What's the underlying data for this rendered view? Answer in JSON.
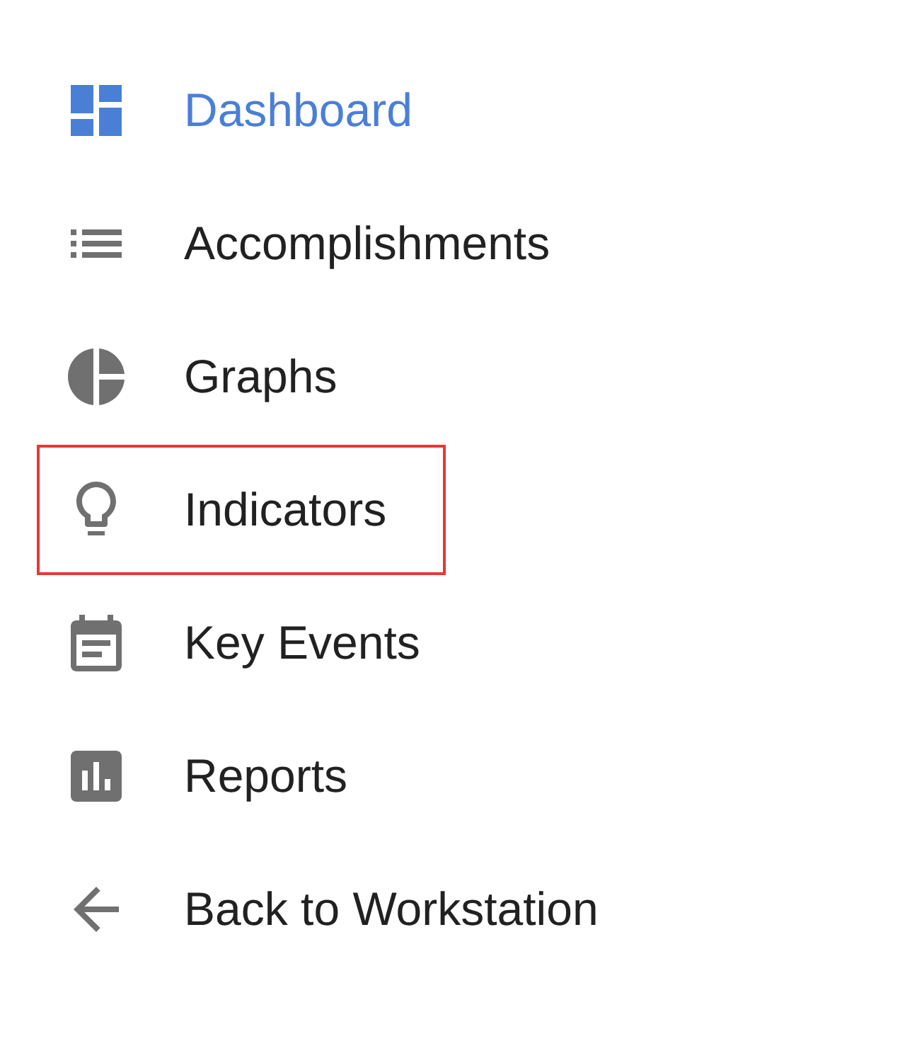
{
  "menu": [
    {
      "label": "Dashboard",
      "kind": "dashboard",
      "selected": true,
      "highlighted": false
    },
    {
      "label": "Accomplishments",
      "kind": "list",
      "selected": false,
      "highlighted": false
    },
    {
      "label": "Graphs",
      "kind": "pie",
      "selected": false,
      "highlighted": false
    },
    {
      "label": "Indicators",
      "kind": "bulb",
      "selected": false,
      "highlighted": true
    },
    {
      "label": "Key Events",
      "kind": "calendar",
      "selected": false,
      "highlighted": false
    },
    {
      "label": "Reports",
      "kind": "report",
      "selected": false,
      "highlighted": false
    },
    {
      "label": "Back to Workstation",
      "kind": "back",
      "selected": false,
      "highlighted": false
    }
  ]
}
